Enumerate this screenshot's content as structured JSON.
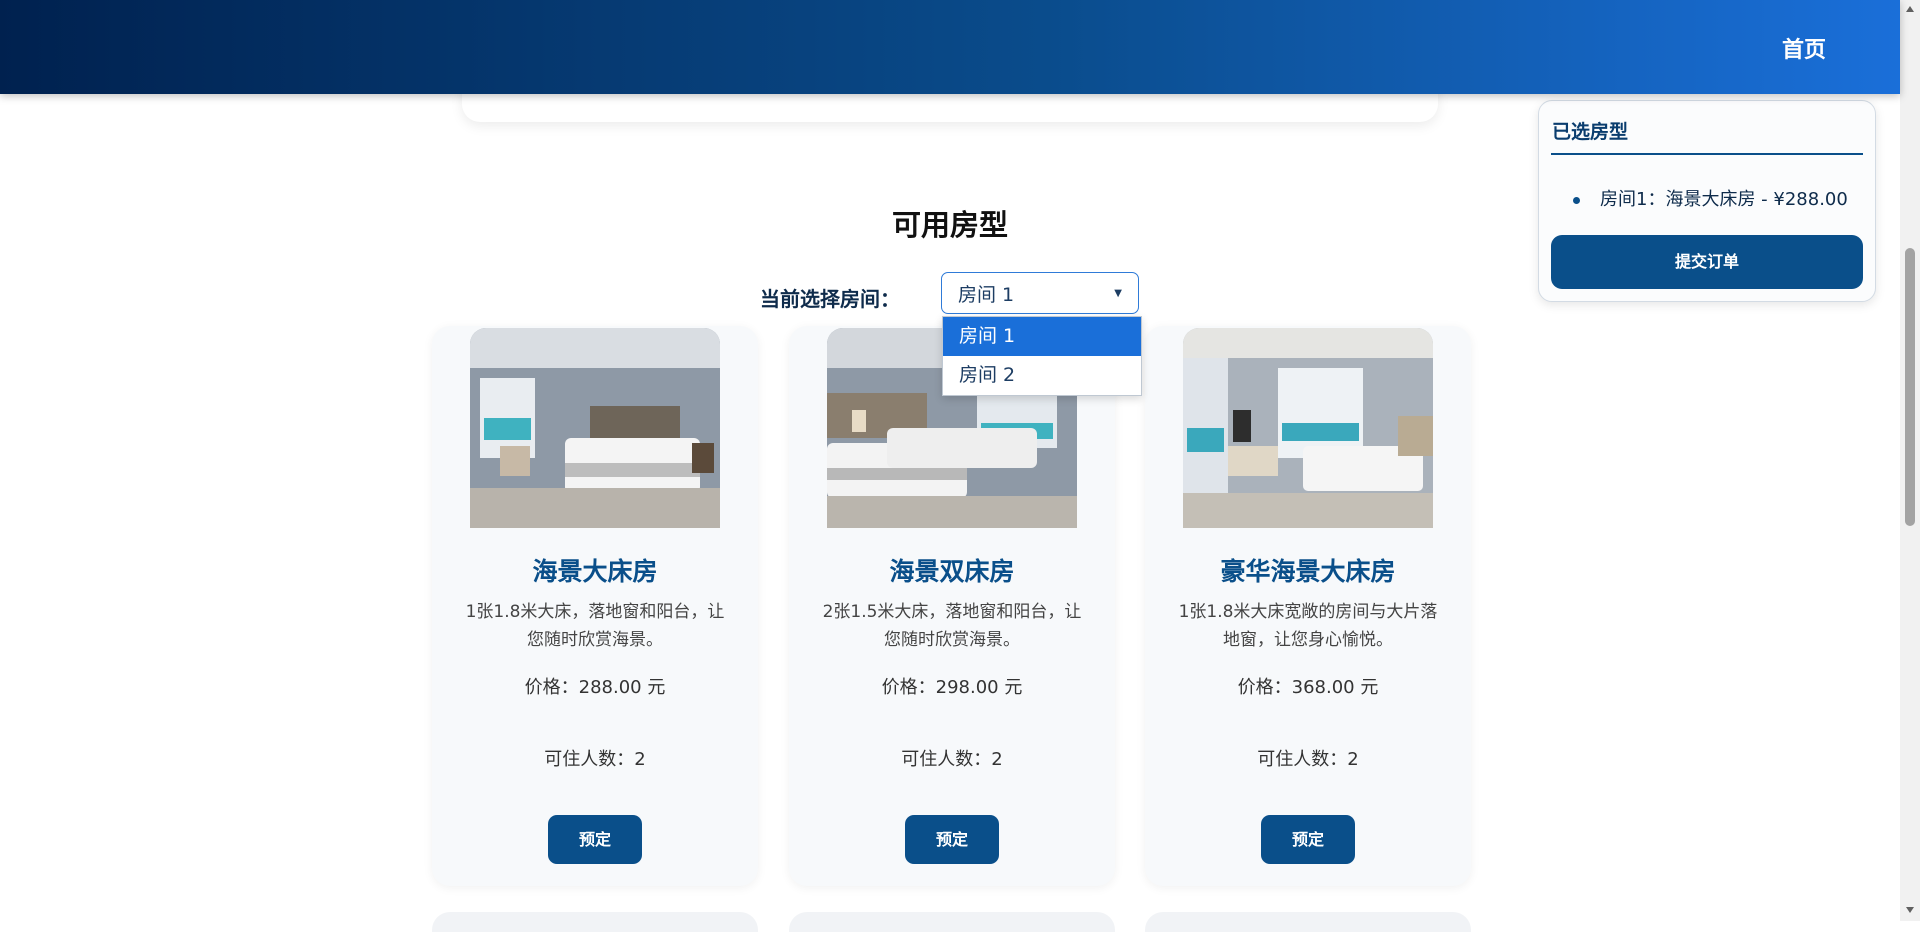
{
  "header": {
    "nav_home": "首页"
  },
  "section": {
    "title": "可用房型"
  },
  "room_selector": {
    "label": "当前选择房间：",
    "selected": "房间 1",
    "options": [
      "房间 1",
      "房间 2"
    ]
  },
  "rooms": [
    {
      "name": "海景大床房",
      "desc": "1张1.8米大床，落地窗和阳台，让您随时欣赏海景。",
      "price": "价格：288.00 元",
      "capacity": "可住人数：2",
      "book_label": "预定"
    },
    {
      "name": "海景双床房",
      "desc": "2张1.5米大床，落地窗和阳台，让您随时欣赏海景。",
      "price": "价格：298.00 元",
      "capacity": "可住人数：2",
      "book_label": "预定"
    },
    {
      "name": "豪华海景大床房",
      "desc": "1张1.8米大床宽敞的房间与大片落地窗，让您身心愉悦。",
      "price": "价格：368.00 元",
      "capacity": "可住人数：2",
      "book_label": "预定"
    }
  ],
  "sidebar": {
    "title": "已选房型",
    "items": [
      "房间1：海景大床房 - ¥288.00"
    ],
    "submit_label": "提交订单"
  },
  "colors": {
    "primary": "#0a4f8a",
    "accent": "#1a6fd9",
    "header_dark": "#00214f"
  }
}
